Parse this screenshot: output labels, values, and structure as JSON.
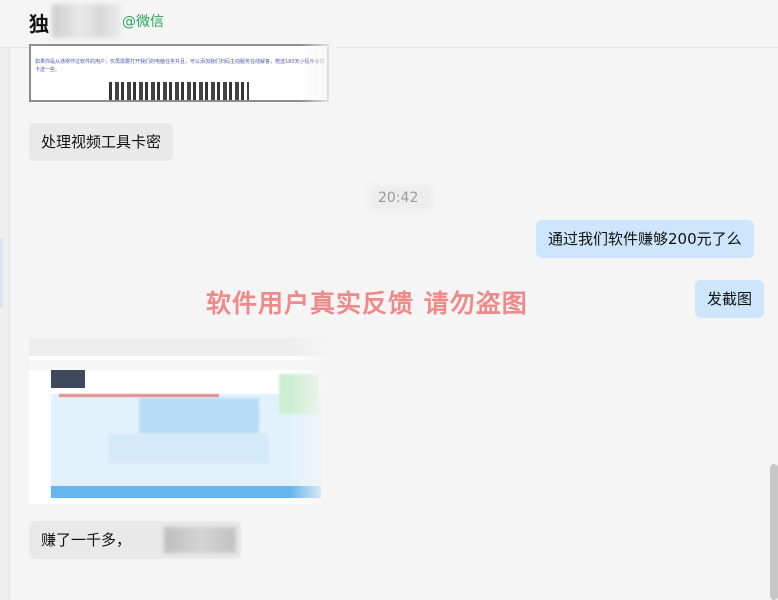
{
  "header": {
    "chat_name": "独",
    "tag": "@微信"
  },
  "messages": {
    "image1_text": "如果你是从通常作过软件的用户，仅再需要打开我们的电脑任务并且，可以添加我们扫码主动服务在线解答，赠送180天小程序会员卡送一些。",
    "bubble1": "处理视频工具卡密",
    "timestamp": "20:42",
    "bubble2": "通过我们软件赚够200元了么",
    "bubble3": "发截图",
    "bubble4": "赚了一千多，"
  },
  "watermark": "软件用户真实反馈  请勿盗图",
  "colors": {
    "bubble_left": "#e9e9e9",
    "bubble_right": "#cde6fb",
    "watermark": "#f08a8a",
    "wechat_tag": "#22a559"
  }
}
